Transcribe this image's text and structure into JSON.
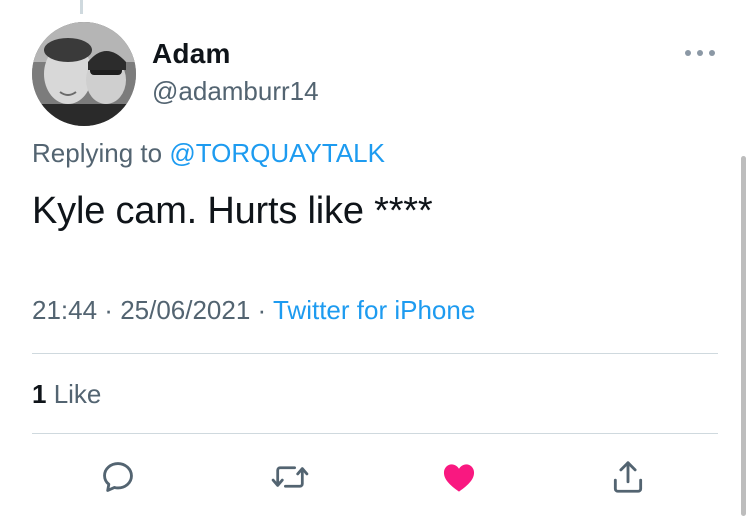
{
  "tweet": {
    "author_name": "Adam",
    "author_handle": "@adamburr14",
    "replying_prefix": "Replying to ",
    "replying_to": "@TORQUAYTALK",
    "text": "Kyle cam. Hurts like ****",
    "time": "21:44",
    "separator": " · ",
    "date": "25/06/2021",
    "source": "Twitter for iPhone",
    "likes_count": "1",
    "likes_label": " Like"
  },
  "actions": {
    "icons": [
      "reply-icon",
      "retweet-icon",
      "like-icon",
      "share-icon"
    ],
    "liked": true
  },
  "colors": {
    "accent": "#1d9bf0",
    "secondary_text": "#536471",
    "like": "#f91880",
    "divider": "#cfd9de"
  }
}
